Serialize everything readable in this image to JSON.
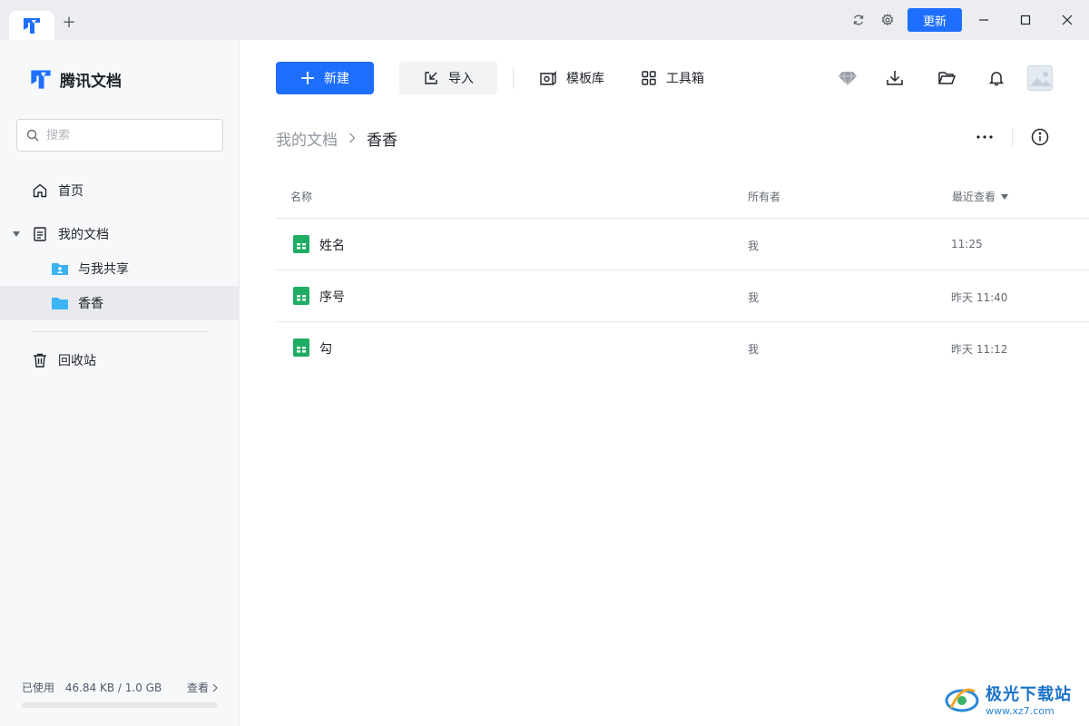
{
  "titlebar": {
    "add_tab": "+",
    "update_label": "更新",
    "icons": [
      "tencent-docs-logo",
      "refresh-icon",
      "settings-icon",
      "minimize-icon",
      "maximize-icon",
      "close-icon"
    ]
  },
  "sidebar": {
    "brand": "腾讯文档",
    "search_placeholder": "搜索",
    "items": [
      {
        "label": "首页",
        "icon": "home-icon"
      },
      {
        "label": "我的文档",
        "icon": "document-icon"
      },
      {
        "label": "与我共享",
        "icon": "shared-folder-icon"
      },
      {
        "label": "香香",
        "icon": "folder-icon"
      },
      {
        "label": "回收站",
        "icon": "trash-icon"
      }
    ],
    "selected_item": "香香",
    "storage": {
      "used_label": "已使用",
      "used_value": "46.84 KB / 1.0 GB",
      "view_label": "查看",
      "used_fraction": 5e-05
    }
  },
  "toolbar": {
    "new_label": "新建",
    "import_label": "导入",
    "template_label": "模板库",
    "toolbox_label": "工具箱",
    "right_icons": [
      "diamond-icon",
      "download-icon",
      "folder-open-icon",
      "bell-icon",
      "avatar"
    ]
  },
  "breadcrumb": {
    "root": "我的文档",
    "separator": ">",
    "current": "香香"
  },
  "table": {
    "columns": [
      "名称",
      "所有者",
      "最近查看"
    ],
    "rows": [
      {
        "name": "姓名",
        "owner": "我",
        "time": "11:25",
        "icon": "sheet-icon"
      },
      {
        "name": "序号",
        "owner": "我",
        "time": "昨天 11:40",
        "icon": "sheet-icon"
      },
      {
        "name": "勾",
        "owner": "我",
        "time": "昨天 11:12",
        "icon": "sheet-icon"
      }
    ]
  },
  "watermark": {
    "title": "极光下载站",
    "url": "www.xz7.com"
  },
  "colors": {
    "accent": "#1e6fff",
    "sheet_green": "#1fad62",
    "folder_blue": "#3db3f5"
  }
}
